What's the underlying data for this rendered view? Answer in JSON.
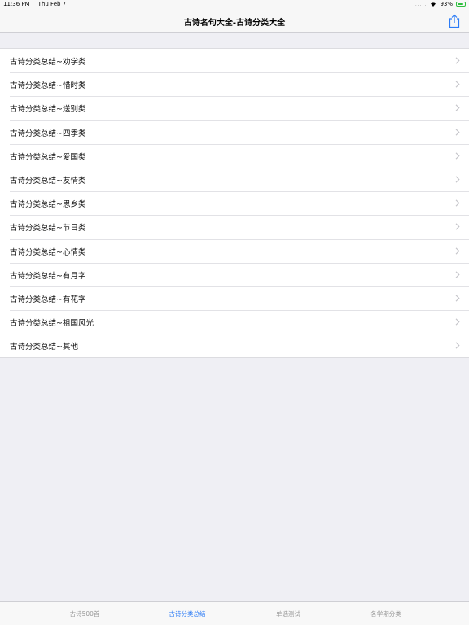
{
  "status_bar": {
    "time": "11:36 PM",
    "date": "Thu Feb 7",
    "signal": ".....",
    "battery": "93%",
    "battery_level": 0.93,
    "battery_color": "#2fbf3f"
  },
  "nav": {
    "title": "古诗名句大全-古诗分类大全",
    "share_icon": "share-icon"
  },
  "list": {
    "items": [
      {
        "label": "古诗分类总结~劝学类"
      },
      {
        "label": "古诗分类总结~惜时类"
      },
      {
        "label": "古诗分类总结~送别类"
      },
      {
        "label": "古诗分类总结~四季类"
      },
      {
        "label": "古诗分类总结~爱国类"
      },
      {
        "label": "古诗分类总结~友情类"
      },
      {
        "label": "古诗分类总结~思乡类"
      },
      {
        "label": "古诗分类总结~节日类"
      },
      {
        "label": "古诗分类总结~心情类"
      },
      {
        "label": "古诗分类总结~有月字"
      },
      {
        "label": "古诗分类总结~有花字"
      },
      {
        "label": "古诗分类总结~祖国风光"
      },
      {
        "label": "古诗分类总结~其他"
      }
    ],
    "chevron_icon": "chevron-right-icon"
  },
  "tab_bar": {
    "tabs": [
      {
        "label": "古诗500首"
      },
      {
        "label": "古诗分类总结"
      },
      {
        "label": "单选测试"
      },
      {
        "label": "各学期分类"
      }
    ],
    "active_index": 1,
    "active_color": "#2d7cf6",
    "inactive_color": "#999999"
  }
}
